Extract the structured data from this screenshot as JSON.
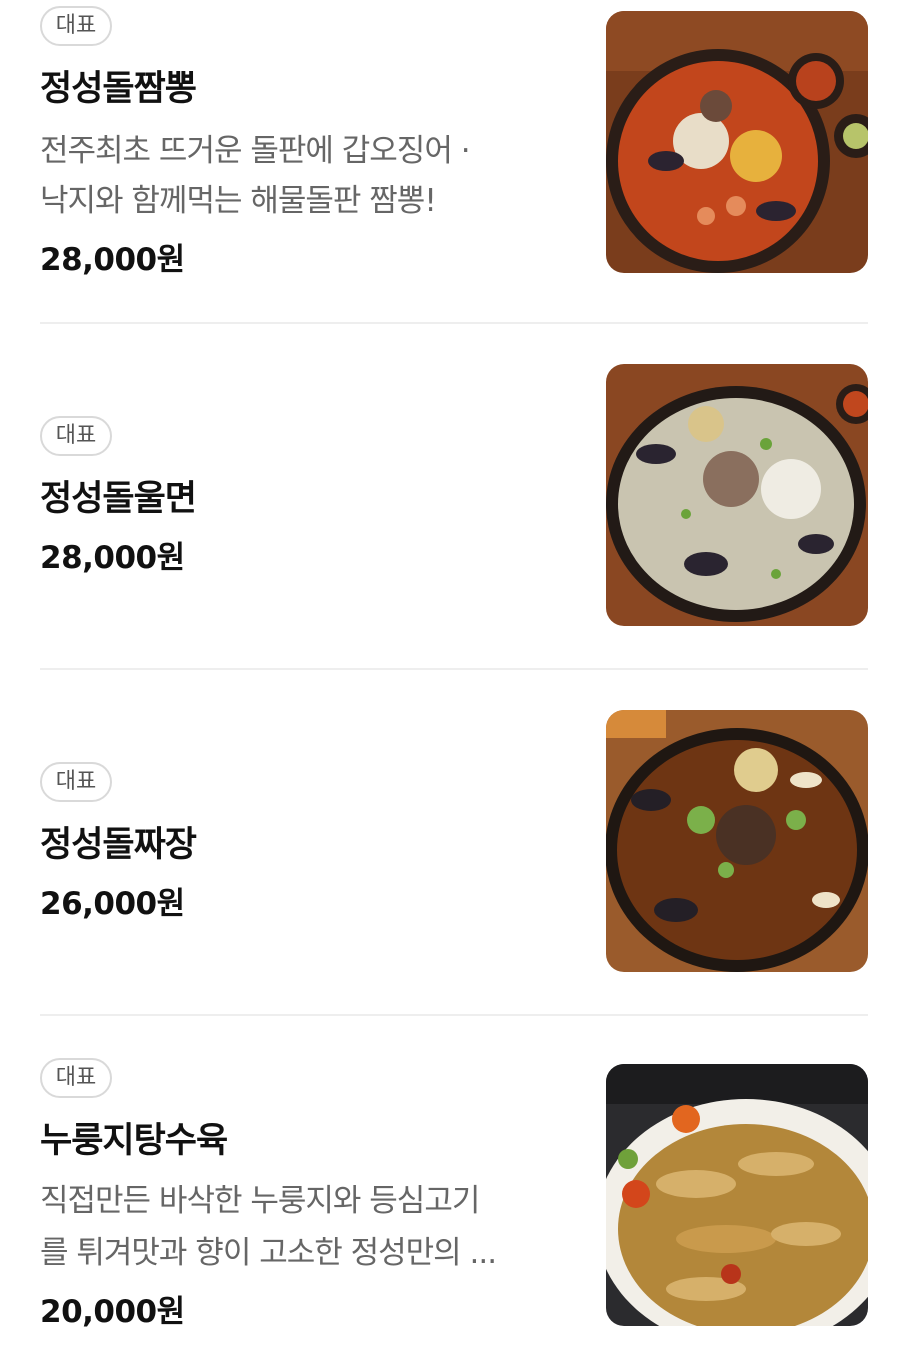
{
  "menu_items": [
    {
      "badge": "대표",
      "name": "정성돌짬뽕",
      "description_line1": "전주최초 뜨거운 돌판에 갑오징어 ·",
      "description_line2": "낙지와 함께먹는 해물돌판 짬뽕!",
      "price": "28,000원",
      "image": "seafood-jjamppong-stone-plate-photo"
    },
    {
      "badge": "대표",
      "name": "정성돌울면",
      "price": "28,000원",
      "image": "seafood-ulmyeon-stone-plate-photo"
    },
    {
      "badge": "대표",
      "name": "정성돌짜장",
      "price": "26,000원",
      "image": "jjajang-stone-plate-photo"
    },
    {
      "badge": "대표",
      "name": "누룽지탕수육",
      "description_line1": "직접만든 바삭한 누룽지와 등심고기",
      "description_line2": "를 튀겨맛과 향이 고소한 정성만의 ...",
      "price": "20,000원",
      "image": "nurungji-tangsuyuk-plate-photo"
    }
  ],
  "colors": {
    "badge_border": "#d9d9d9",
    "description_text": "#666666",
    "price_text": "#111111",
    "divider": "#eeeeee"
  }
}
